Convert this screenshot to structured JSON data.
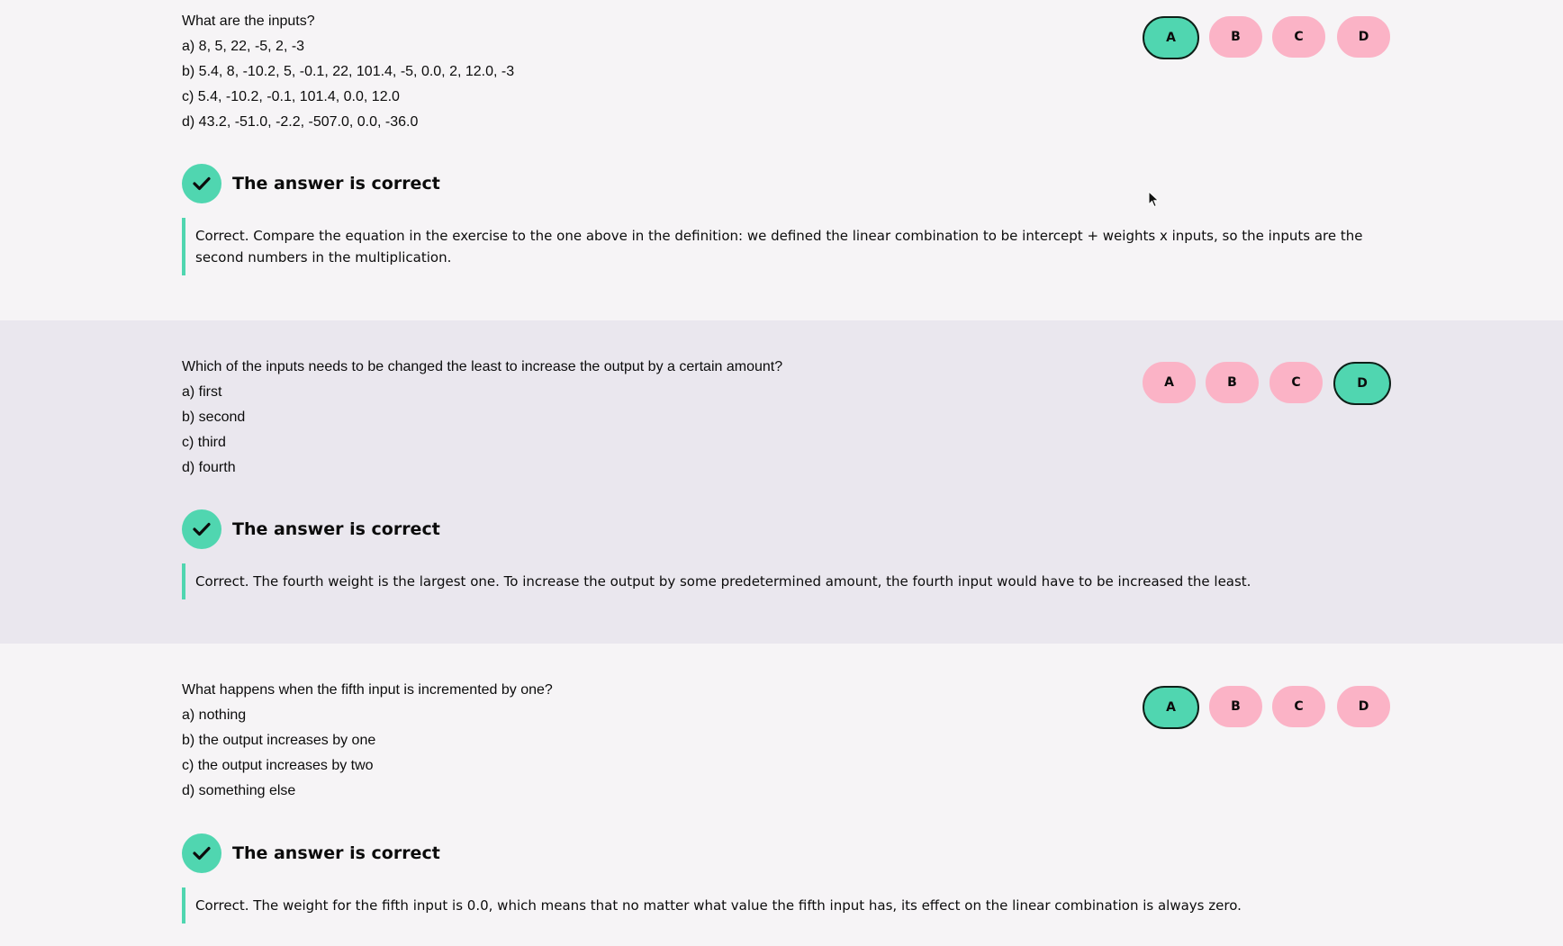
{
  "questions": [
    {
      "prompt": "What are the inputs?",
      "options": [
        "a) 8, 5, 22, -5, 2, -3",
        "b) 5.4, 8, -10.2, 5, -0.1, 22, 101.4, -5, 0.0, 2, 12.0, -3",
        "c) 5.4, -10.2, -0.1, 101.4, 0.0, 12.0",
        "d) 43.2, -51.0, -2.2, -507.0, 0.0, -36.0"
      ],
      "buttons": [
        "A",
        "B",
        "C",
        "D"
      ],
      "selected": "A",
      "feedback_title": "The answer is correct",
      "feedback_text": "Correct. Compare the equation in the exercise to the one above in the definition: we defined the linear combination to be intercept + weights x inputs, so the inputs are the second numbers in the multiplication."
    },
    {
      "prompt": "Which of the inputs needs to be changed the least to increase the output by a certain amount?",
      "options": [
        "a) first",
        "b) second",
        "c) third",
        "d) fourth"
      ],
      "buttons": [
        "A",
        "B",
        "C",
        "D"
      ],
      "selected": "D",
      "feedback_title": "The answer is correct",
      "feedback_text": "Correct. The fourth weight is the largest one. To increase the output by some predetermined amount, the fourth input would have to be increased the least."
    },
    {
      "prompt": "What happens when the fifth input is incremented by one?",
      "options": [
        "a) nothing",
        "b) the output increases by one",
        "c) the output increases by two",
        "d) something else"
      ],
      "buttons": [
        "A",
        "B",
        "C",
        "D"
      ],
      "selected": "A",
      "feedback_title": "The answer is correct",
      "feedback_text": "Correct. The weight for the fifth input is 0.0, which means that no matter what value the fifth input has, its effect on the linear combination is always zero."
    }
  ],
  "colors": {
    "correct": "#50d6b0",
    "option": "#fbb3c6",
    "band": "#eae7ee",
    "page": "#f6f4f6"
  },
  "icons": {
    "feedback": "checkmark-icon",
    "pointer": "mouse-cursor-icon"
  }
}
